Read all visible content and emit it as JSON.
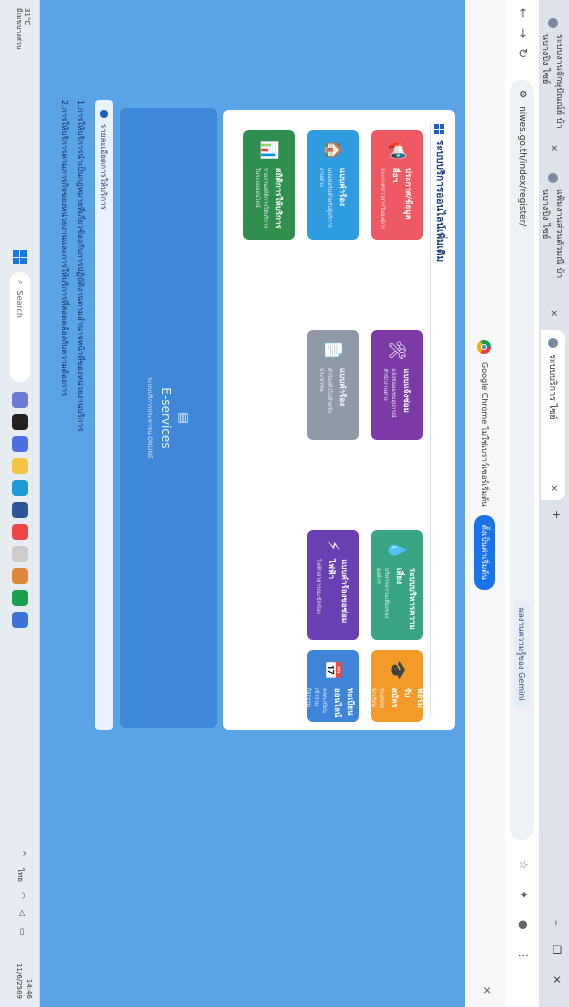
{
  "browser": {
    "tabs": [
      {
        "title": "ระบบงานจักษุปัณณ์ย์ บ้านบางปิง ไซย์"
      },
      {
        "title": "แฟ้มงานส่วนตัวมณี บ้านบางปิง ไซย์"
      },
      {
        "title": "ระบบบริการ ไซย์"
      }
    ],
    "new_tab": "+",
    "url": "niwes.go.th/index/register/",
    "gemini_label": "ผลงานความรู้ของ Gemini"
  },
  "infobar": {
    "message": "Google Chrome ไม่ใช่เบราว์เซอร์เริ่มต้น",
    "button": "ตั้งเป็นค่าเริ่มต้น"
  },
  "page": {
    "section_title": "ระบบบริการออนไลน์เพิ่มเติม",
    "cards": [
      {
        "title": "ประกาศ/ข้อมูลสื่อฯ",
        "sub": "ประกาศข่าวสารในองค์กร",
        "icon": "📢"
      },
      {
        "title": "แบบคำร้อง",
        "sub": "แบบฟอร์มสำหรับผู้บริการงานต่าง",
        "icon": "🏠"
      },
      {
        "title": "สถิติการให้บริการ",
        "sub": "รายงานสถิติการให้บริการในระบบออนไลน์",
        "icon": "📊"
      },
      {
        "title": "แบบแจ้งซ่อม",
        "sub": "แจ้งซ่อมแซมอุปกรณ์สำนักงานต่าง",
        "icon": "🛠"
      },
      {
        "title": "แบบคำร้อง",
        "sub": "คำร้องทั่วไปสำหรับประชาชน",
        "icon": "📄"
      },
      {
        "title": "ระบบบริหารความเสี่ยง",
        "sub": "บริหารความเสี่ยงขององค์กร",
        "icon": "💧"
      },
      {
        "title": "แบบคำร้องขอซ่อมไฟฟ้า",
        "sub": "ไฟฟ้าสาธารณะขัดข้อง",
        "icon": "⚡"
      },
      {
        "title": "แบบฟอร์มรับสมัคร",
        "sub": "รับสมัครนักเรียนเข้าศึกษาต่อ",
        "icon": "🎓"
      },
      {
        "title": "ลงทะเบียนออนไลน์",
        "sub": "ลงทะเบียนเข้าร่วมกิจกรรมออนไลน์",
        "icon": "📅"
      }
    ],
    "eservices": {
      "title": "E-services",
      "sub": "ระบบบริการประชาชน ONLINE"
    },
    "stats_label": "รายละเอียดการให้บริการ",
    "notes": [
      "1.การให้บริการนำเป็นกฎหมายที่เกี่ยวข้องกับการปฏิบัติงานตามอำนาจหน้าที่ของหน่วยงานบริการ",
      "2.การให้บริการตามภารกิจของหน่วยงานและการให้บริการที่สอดคล้องกับความต้องการ"
    ]
  },
  "taskbar": {
    "weather_temp": "31°C",
    "weather_desc": "มีเมฆบางส่วน",
    "search_placeholder": "Search",
    "time": "14:46",
    "date": "11/6/2569",
    "lang": "ไทย"
  },
  "colors": {
    "card_colors": [
      "#ee5a64",
      "#2f9ce0",
      "#2f8f4e",
      "#7b3aa6",
      "#8f9aa6",
      "#3aa584",
      "#6a3fb1",
      "#f39a2a",
      "#3f84d8"
    ]
  }
}
